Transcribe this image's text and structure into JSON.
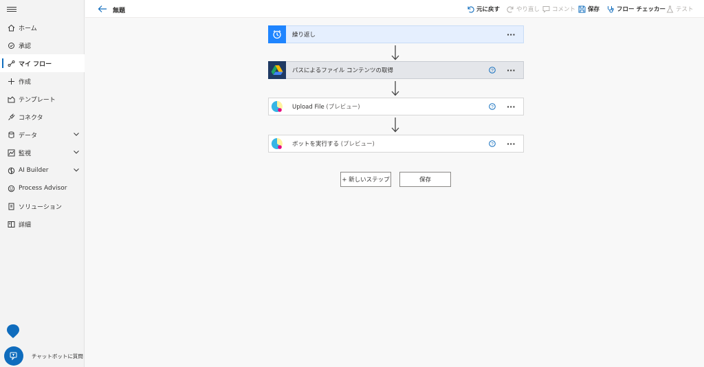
{
  "sidebar": {
    "items": [
      {
        "label": "ホーム"
      },
      {
        "label": "承認"
      },
      {
        "label": "マイ フロー"
      },
      {
        "label": "作成"
      },
      {
        "label": "テンプレート"
      },
      {
        "label": "コネクタ"
      },
      {
        "label": "データ"
      },
      {
        "label": "監視"
      },
      {
        "label": "AI Builder"
      },
      {
        "label": "Process Advisor"
      },
      {
        "label": "ソリューション"
      },
      {
        "label": "詳細"
      }
    ],
    "chat_label": "チャットボットに質問"
  },
  "header": {
    "title": "無題",
    "undo": "元に戻す",
    "redo": "やり直し",
    "comment": "コメント",
    "save": "保存",
    "flow_checker": "フロー チェッカー",
    "test": "テスト"
  },
  "steps": [
    {
      "title": "繰り返し",
      "sub": "",
      "icon": "clock-icon"
    },
    {
      "title": "パスによるファイル コンテンツの取得",
      "sub": "",
      "icon": "google-drive-icon"
    },
    {
      "title": "Upload File",
      "sub": " (プレビュー)",
      "icon": "connector-icon"
    },
    {
      "title": "ボットを実行する",
      "sub": " (プレビュー)",
      "icon": "connector-icon"
    }
  ],
  "actions": {
    "new_step": "+ 新しいステップ",
    "save": "保存"
  },
  "colors": {
    "accent": "#0f6cbd",
    "trigger_bg": "#e5effe"
  }
}
